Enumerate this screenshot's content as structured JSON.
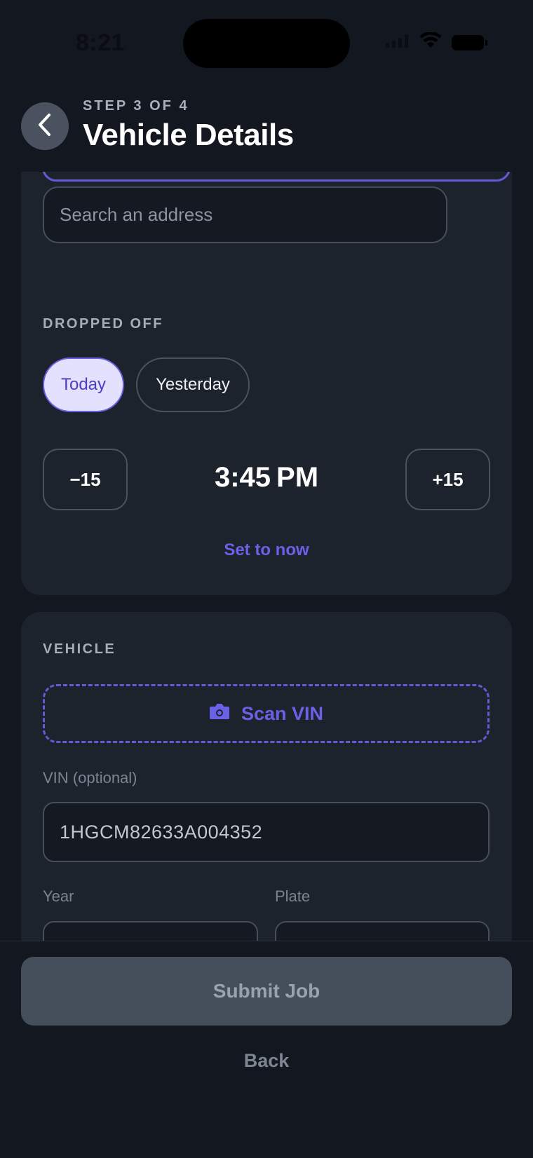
{
  "status": {
    "time": "8:21"
  },
  "header": {
    "step": "STEP 3 OF 4",
    "title": "Vehicle Details"
  },
  "address": {
    "placeholder": "Search an address"
  },
  "dropped_off": {
    "label": "DROPPED OFF",
    "chips": [
      "Today",
      "Yesterday"
    ],
    "selected_chip": "Today",
    "minus_label": "−15",
    "plus_label": "+15",
    "time": "3:45 PM",
    "set_now": "Set to now"
  },
  "vehicle": {
    "label": "VEHICLE",
    "scan_label": "Scan VIN",
    "vin_label": "VIN (optional)",
    "vin_value": "1HGCM82633A004352",
    "year_label": "Year",
    "plate_label": "Plate"
  },
  "footer": {
    "submit": "Submit Job",
    "back": "Back"
  },
  "colors": {
    "accent": "#6b61e6",
    "background": "#13171f",
    "card": "#1c232d"
  },
  "icons": {
    "back": "chevron-left-icon",
    "camera": "camera-icon",
    "wifi": "wifi-icon",
    "battery": "battery-icon"
  }
}
